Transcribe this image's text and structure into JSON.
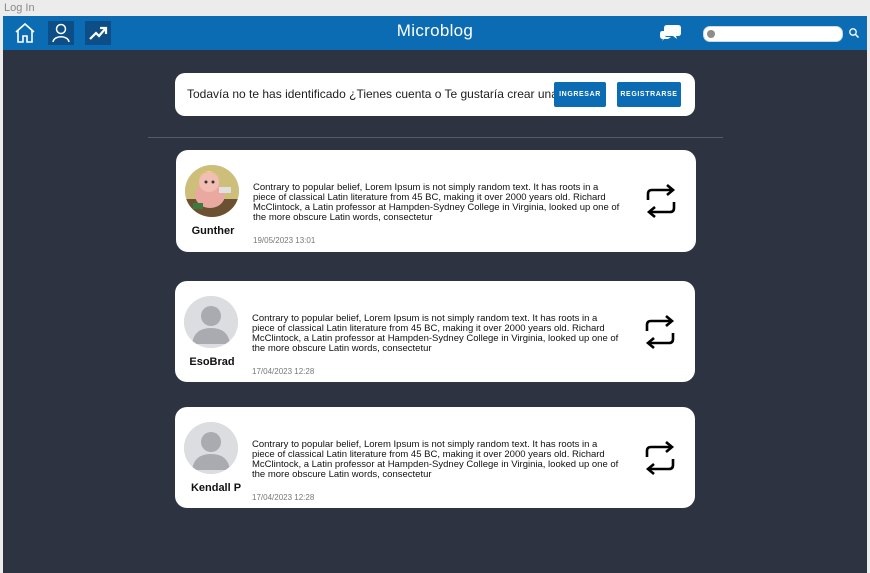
{
  "window": {
    "title": "Log In"
  },
  "navbar": {
    "title": "Microblog",
    "icons": [
      "home-icon",
      "user-icon",
      "trending-icon",
      "chat-icon",
      "search-icon"
    ],
    "brand_color": "#0b6bb3",
    "search": {
      "value": "",
      "placeholder": ""
    }
  },
  "login_prompt": {
    "text": "Todavía no te has identificado ¿Tienes cuenta o Te gustaría crear una?",
    "login_label": "INGRESAR",
    "register_label": "REGISTRARSE"
  },
  "posts": [
    {
      "author": "Gunther",
      "avatar": "cartoon-character-avatar",
      "text": "Contrary to popular belief, Lorem Ipsum is not simply random text. It has roots in a piece of classical Latin literature from 45 BC, making it over 2000 years old. Richard McClintock, a Latin professor at Hampden-Sydney College in Virginia, looked up one of the more obscure Latin words, consectetur",
      "date": "19/05/2023 13:01"
    },
    {
      "author": "EsoBrad",
      "avatar": "default-avatar",
      "text": "Contrary to popular belief, Lorem Ipsum is not simply random text. It has roots in a piece of classical Latin literature from 45 BC, making it over 2000 years old. Richard McClintock, a Latin professor at Hampden-Sydney College in Virginia, looked up one of the more obscure Latin words, consectetur",
      "date": "17/04/2023 12:28"
    },
    {
      "author": "Kendall  P",
      "avatar": "default-avatar",
      "text": "Contrary to popular belief, Lorem Ipsum is not simply random text. It has roots in a piece of classical Latin literature from 45 BC, making it over 2000 years old. Richard McClintock, a Latin professor at Hampden-Sydney College in Virginia, looked up one of the more obscure Latin words, consectetur",
      "date": "17/04/2023 12:28"
    }
  ]
}
